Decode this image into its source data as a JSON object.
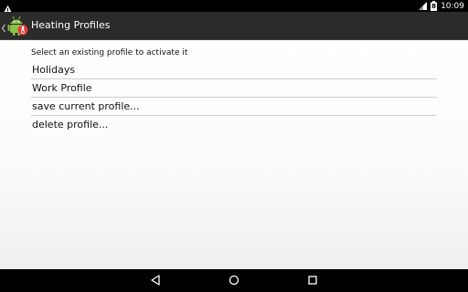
{
  "status_bar": {
    "time": "10:09",
    "battery_level": "8",
    "left_icon": "warning-triangle-icon",
    "signal_icon": "signal-icon",
    "battery_icon": "battery-icon",
    "bg_color": "#000000"
  },
  "action_bar": {
    "title": "Heating Profiles",
    "up_icon": "chevron-left-icon",
    "app_icon": "android-app-icon",
    "bg_color": "#2b2b2b"
  },
  "main": {
    "instruction": "Select an existing profile to activate it",
    "items": [
      {
        "label": "Holidays"
      },
      {
        "label": "Work Profile"
      },
      {
        "label": "save current profile..."
      },
      {
        "label": "delete profile..."
      }
    ]
  },
  "nav_bar": {
    "back_icon": "back-triangle-icon",
    "home_icon": "home-circle-icon",
    "recents_icon": "recents-square-icon",
    "bg_color": "#000000"
  }
}
